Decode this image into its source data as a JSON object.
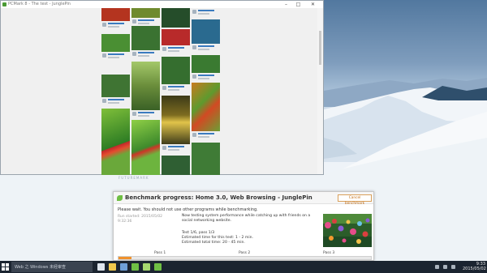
{
  "window": {
    "title": "PCMark 8 - The test - JunglePin",
    "controls": {
      "minimize": "–",
      "maximize": "□",
      "close": "✕"
    },
    "pins": [
      {
        "color": "#2f7d2a"
      },
      {
        "color": "#4f9a35"
      },
      {
        "color": "#8ab84a"
      },
      {
        "color": "#6a9c2c"
      },
      {
        "color": "#b92b2b"
      },
      {
        "color": "#3f7d38"
      },
      {
        "color": "#c98524"
      },
      {
        "color": "#e0c54a"
      },
      {
        "color": "#64a83b"
      }
    ]
  },
  "desktop_watermark": "FUTUREMARK",
  "dialog": {
    "title": "Benchmark progress: Home 3.0, Web Browsing - JunglePin",
    "cancel_label": "Cancel benchmark",
    "wait_text": "Please wait. You should not use other programs while benchmarking.",
    "started_line1": "Run started: 2015/05/02",
    "started_line2": "9:32:36",
    "description": "Now testing system performance while catching up with friends on a social networking website.",
    "test_line": "Test 1/6, pass 1/3",
    "est_test": "Estimated time for this test: 1 - 2 min.",
    "est_total": "Estimated total time: 20 - 45 min.",
    "progress_fraction": 0.05,
    "passes": [
      "Pass 1",
      "Pass 2",
      "Pass 3"
    ],
    "colors": {
      "accent": "#f0912c",
      "cancel_border": "#d9a05b",
      "cancel_text": "#c46d12"
    }
  },
  "taskbar": {
    "search_text": "Web 之 Windows 未经审查",
    "clock_time": "9:33",
    "clock_date": "2015/05/02",
    "apps": [
      {
        "name": "task-view",
        "color": "#dfe6ee"
      },
      {
        "name": "file-explorer",
        "color": "#f2c94c"
      },
      {
        "name": "store",
        "color": "#6fa0d8"
      },
      {
        "name": "pcmark-app-1",
        "color": "#6fbf44"
      },
      {
        "name": "pcmark-app-2",
        "color": "#a6d86f"
      },
      {
        "name": "pcmark-app-3",
        "color": "#6fbf44"
      }
    ]
  }
}
